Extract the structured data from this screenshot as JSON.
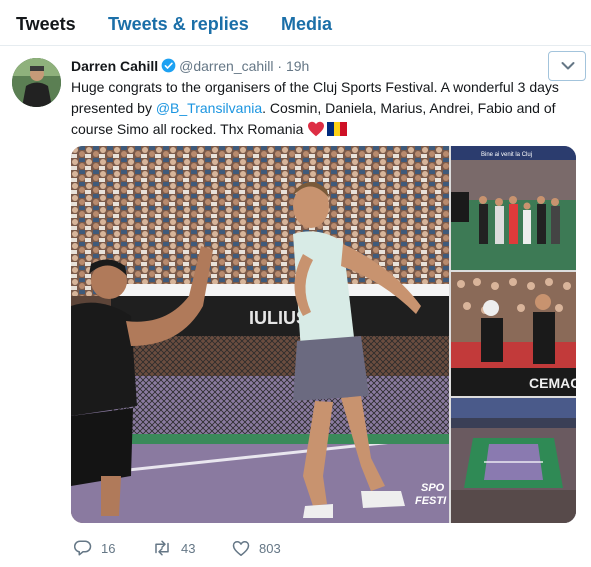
{
  "tabs": [
    {
      "label": "Tweets"
    },
    {
      "label": "Tweets & replies"
    },
    {
      "label": "Media"
    }
  ],
  "tweet": {
    "author_name": "Darren Cahill",
    "handle": "@darren_cahill",
    "separator": "·",
    "time": "19h",
    "text_part1": "Huge congrats to the organisers of the Cluj Sports Festival. A wonderful 3 days presented by ",
    "mention": "@B_Transilvania",
    "text_part2": ". Cosmin, Daniela, Marius, Andrei, Fabio and of course Simo all rocked. Thx Romania ",
    "emoji": [
      "red-heart-icon",
      "romania-flag-icon"
    ],
    "media_text": {
      "banner": "IULIUSMA",
      "corner": "SPO\nFESTI",
      "thumb2_banner": "CEMACO",
      "thumb1_banner": "Bine ai venit la Cluj"
    },
    "actions": {
      "reply_count": "16",
      "retweet_count": "43",
      "like_count": "803"
    }
  },
  "colors": {
    "link": "#1b95e0",
    "tab_inactive": "#1b6fa8",
    "muted": "#657786",
    "verified": "#1da1f2",
    "heart": "#e0245e"
  }
}
